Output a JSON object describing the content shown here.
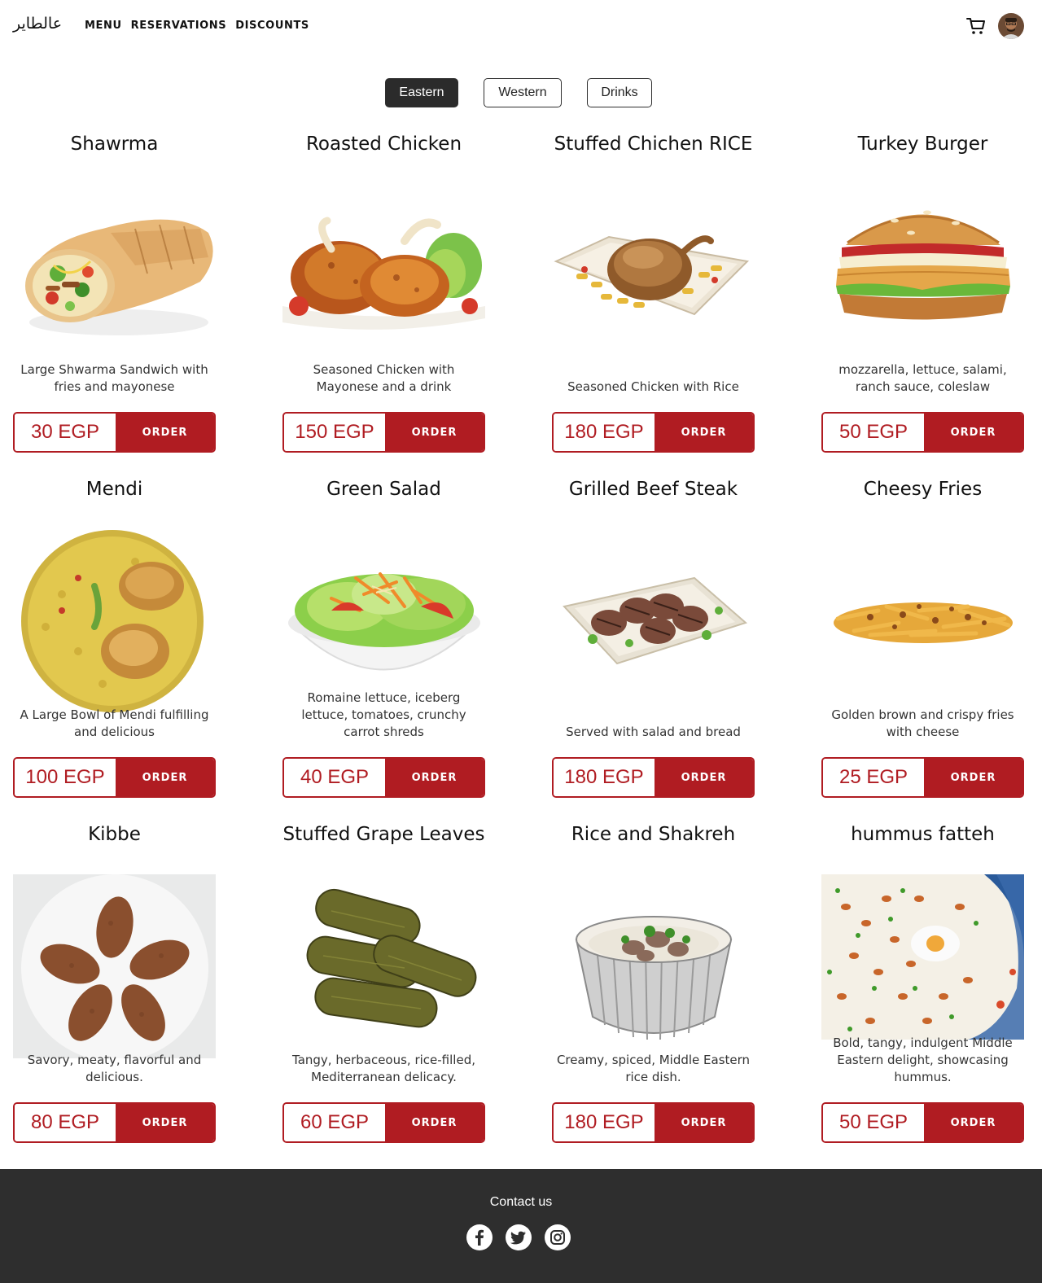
{
  "header": {
    "logo_text": "عالطاير",
    "nav": [
      {
        "label": "MENU"
      },
      {
        "label": "RESERVATIONS"
      },
      {
        "label": "DISCOUNTS"
      }
    ],
    "cart_icon": "cart-icon",
    "avatar_icon": "user-avatar"
  },
  "tabs": [
    {
      "label": "Eastern",
      "active": true
    },
    {
      "label": "Western",
      "active": false
    },
    {
      "label": "Drinks",
      "active": false
    }
  ],
  "order_label": "ORDER",
  "items": [
    {
      "name": "Shawrma",
      "desc": "Large Shwarma Sandwich with fries and mayonese",
      "price": "30 EGP",
      "image": "shawarma-wrap"
    },
    {
      "name": "Roasted Chicken",
      "desc": "Seasoned Chicken with Mayonese and a drink",
      "price": "150 EGP",
      "image": "roasted-chicken-legs"
    },
    {
      "name": "Stuffed Chichen RICE",
      "desc": "Seasoned Chicken with Rice",
      "price": "180 EGP",
      "image": "whole-chicken-plate"
    },
    {
      "name": "Turkey Burger",
      "desc": "mozzarella, lettuce, salami, ranch sauce, coleslaw",
      "price": "50 EGP",
      "image": "burger"
    },
    {
      "name": "Mendi",
      "desc": "A Large Bowl of Mendi fulfilling and delicious",
      "price": "100 EGP",
      "image": "mendi-rice"
    },
    {
      "name": "Green Salad",
      "desc": "Romaine lettuce, iceberg lettuce, tomatoes, crunchy carrot shreds",
      "price": "40 EGP",
      "image": "salad-bowl"
    },
    {
      "name": "Grilled Beef Steak",
      "desc": "Served with salad and bread",
      "price": "180 EGP",
      "image": "steak-plate"
    },
    {
      "name": "Cheesy Fries",
      "desc": "Golden brown and crispy fries with cheese",
      "price": "25 EGP",
      "image": "cheesy-fries"
    },
    {
      "name": "Kibbe",
      "desc": "Savory, meaty, flavorful and delicious.",
      "price": "80 EGP",
      "image": "kibbe-plate"
    },
    {
      "name": "Stuffed Grape Leaves",
      "desc": "Tangy, herbaceous, rice-filled, Mediterranean delicacy.",
      "price": "60 EGP",
      "image": "grape-leaves"
    },
    {
      "name": "Rice and Shakreh",
      "desc": "Creamy, spiced, Middle Eastern rice dish.",
      "price": "180 EGP",
      "image": "shakreh-bowl"
    },
    {
      "name": "hummus fatteh",
      "desc": "Bold, tangy, indulgent Middle Eastern delight, showcasing hummus.",
      "price": "50 EGP",
      "image": "hummus-fatteh"
    }
  ],
  "footer": {
    "contact_label": "Contact us",
    "socials": [
      "facebook-icon",
      "twitter-icon",
      "instagram-icon"
    ]
  },
  "colors": {
    "accent": "#b01c22",
    "footer_bg": "#2e2e2e",
    "active_tab": "#2b2b2b"
  }
}
